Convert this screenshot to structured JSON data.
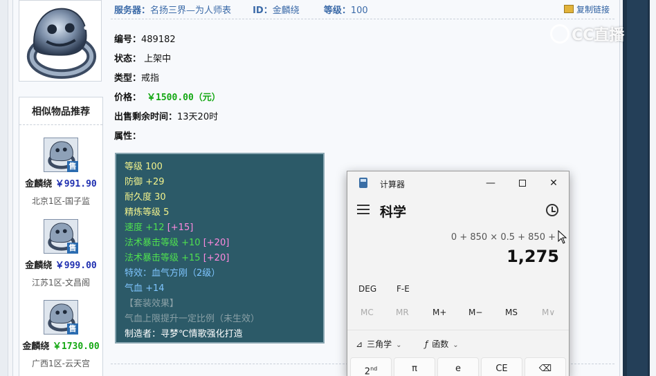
{
  "listing": {
    "header": {
      "server_label": "服务器：",
      "server_value": "名扬三界—为人师表",
      "id_label": "ID：",
      "id_value": "金麟绕",
      "level_label": "等级：",
      "level_value": "100",
      "copy_link": "复制链接"
    },
    "fields": {
      "code_label": "编号：",
      "code_value": "489182",
      "status_label": "状态：",
      "status_value": "上架中",
      "type_label": "类型：",
      "type_value": "戒指",
      "price_label": "价格：",
      "price_value": "￥1500.00（元）",
      "time_label": "出售剩余时间：",
      "time_value": "13天20时",
      "attr_label": "属性："
    },
    "attributes": [
      {
        "text": "等级 100",
        "color": "#f2f28c"
      },
      {
        "text": "防御 +29",
        "color": "#f2f28c"
      },
      {
        "text": "耐久度 30",
        "color": "#f2f28c"
      },
      {
        "text": "精炼等级 5",
        "color": "#f2f28c"
      },
      {
        "text": "速度 +12",
        "extra": "[+15]",
        "color": "#4fe04f"
      },
      {
        "text": "法术暴击等级 +10",
        "extra": "[+20]",
        "color": "#4fe04f"
      },
      {
        "text": "法术暴击等级 +15",
        "extra": "[+20]",
        "color": "#4fe04f"
      },
      {
        "text": "特效：血气方刚（2级）",
        "color": "#7fc5ff"
      },
      {
        "text": "气血 +14",
        "color": "#7fc5ff"
      },
      {
        "text": "【套装效果】",
        "color": "#8aa0a6"
      },
      {
        "text": "气血上限提升一定比例（未生效）",
        "color": "#8aa0a6"
      },
      {
        "text": "制造者：寻梦℃情歌强化打造",
        "color": "#ffffff"
      }
    ]
  },
  "similar": {
    "title": "相似物品推荐",
    "badge": "售",
    "items": [
      {
        "seller": "金麟绕",
        "price": "￥991.90",
        "price_color": "#1f2fb0",
        "server": "北京1区-国子监"
      },
      {
        "seller": "金麟绕",
        "price": "￥999.00",
        "price_color": "#1f2fb0",
        "server": "江苏1区-文昌阁"
      },
      {
        "seller": "金麟绕",
        "price": "￥1730.00",
        "price_color": "#15a814",
        "server": "广西1区-云天宫"
      }
    ]
  },
  "watermark": {
    "text": "CC直播"
  },
  "calculator": {
    "app_title": "计算器",
    "mode": "科学",
    "expression": "0 + 850 × 0.5 + 850 +",
    "result": "1,275",
    "angle_unit": "DEG",
    "fe_label": "F-E",
    "memory": [
      "MC",
      "MR",
      "M+",
      "M−",
      "MS",
      "M∨"
    ],
    "trig_label": "三角学",
    "func_label": "函数",
    "keys": [
      "2",
      "π",
      "e",
      "CE"
    ],
    "key_2_sup": "nd"
  }
}
